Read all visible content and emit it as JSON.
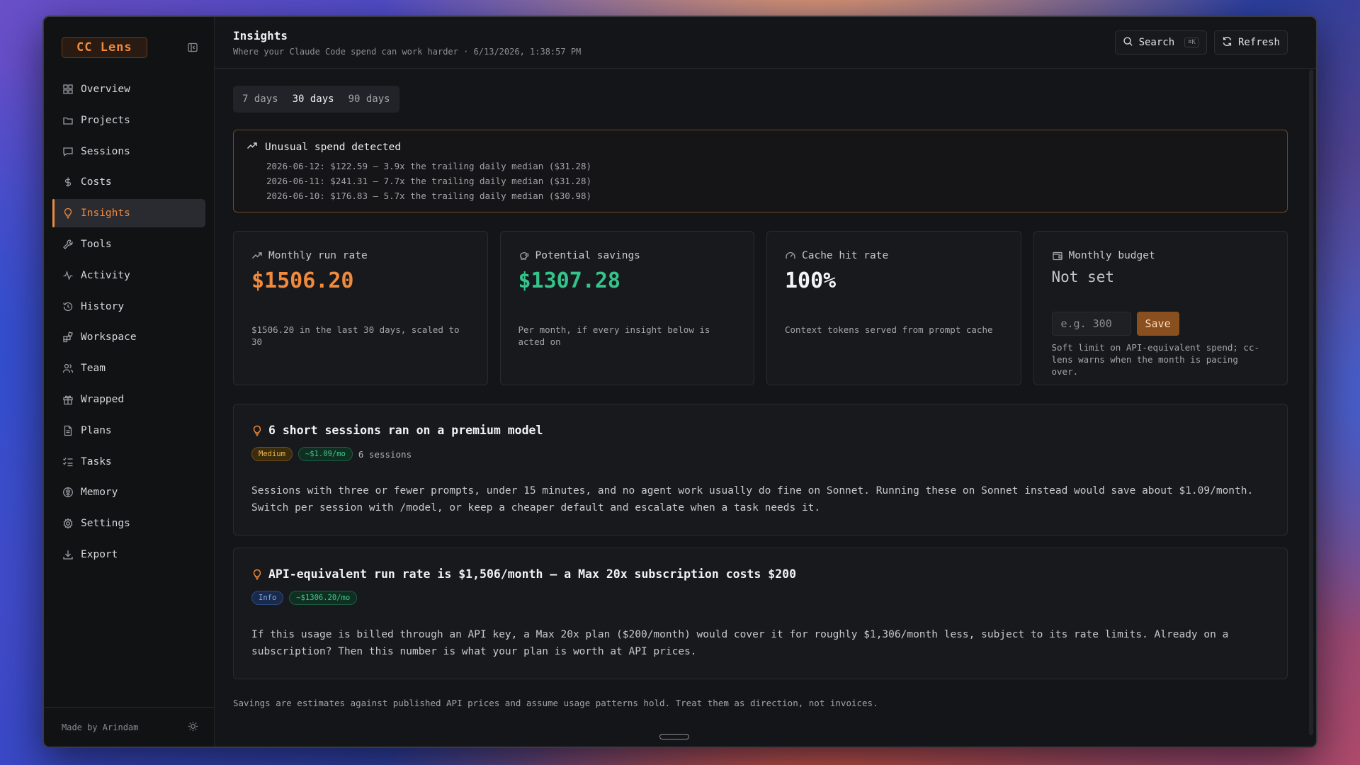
{
  "brand": {
    "name": "CC Lens"
  },
  "sidebar": {
    "items": [
      {
        "label": "Overview",
        "icon": "grid-icon"
      },
      {
        "label": "Projects",
        "icon": "folder-icon"
      },
      {
        "label": "Sessions",
        "icon": "chat-icon"
      },
      {
        "label": "Costs",
        "icon": "dollar-icon"
      },
      {
        "label": "Insights",
        "icon": "lightbulb-icon",
        "active": true
      },
      {
        "label": "Tools",
        "icon": "wrench-icon"
      },
      {
        "label": "Activity",
        "icon": "pulse-icon"
      },
      {
        "label": "History",
        "icon": "history-icon"
      },
      {
        "label": "Workspace",
        "icon": "blocks-icon"
      },
      {
        "label": "Team",
        "icon": "users-icon"
      },
      {
        "label": "Wrapped",
        "icon": "gift-icon"
      },
      {
        "label": "Plans",
        "icon": "document-icon"
      },
      {
        "label": "Tasks",
        "icon": "checklist-icon"
      },
      {
        "label": "Memory",
        "icon": "brain-icon"
      },
      {
        "label": "Settings",
        "icon": "gear-icon"
      },
      {
        "label": "Export",
        "icon": "download-icon"
      }
    ],
    "footer": "Made by Arindam"
  },
  "header": {
    "title": "Insights",
    "subtitle": "Where your Claude Code spend can work harder · 6/13/2026, 1:38:57 PM",
    "search_label": "Search",
    "search_shortcut": "⌘K",
    "refresh_label": "Refresh"
  },
  "range": {
    "options": [
      "7 days",
      "30 days",
      "90 days"
    ],
    "selected": "30 days"
  },
  "alert": {
    "title": "Unusual spend detected",
    "lines": [
      "2026-06-12: $122.59 — 3.9x the trailing daily median ($31.28)",
      "2026-06-11: $241.31 — 7.7x the trailing daily median ($31.28)",
      "2026-06-10: $176.83 — 5.7x the trailing daily median ($30.98)"
    ]
  },
  "stats": {
    "run_rate": {
      "label": "Monthly run rate",
      "value": "$1506.20",
      "desc": "$1506.20 in the last 30 days, scaled to 30"
    },
    "savings": {
      "label": "Potential savings",
      "value": "$1307.28",
      "desc": "Per month, if every insight below is acted on"
    },
    "cache": {
      "label": "Cache hit rate",
      "value": "100%",
      "desc": "Context tokens served from prompt cache"
    },
    "budget": {
      "label": "Monthly budget",
      "value": "Not set",
      "placeholder": "e.g. 300",
      "save_label": "Save",
      "desc": "Soft limit on API-equivalent spend; cc-lens warns when the month is pacing over."
    }
  },
  "insights": [
    {
      "title": "6 short sessions ran on a premium model",
      "severity": "Medium",
      "saving": "~$1.09/mo",
      "meta": "6 sessions",
      "body": "Sessions with three or fewer prompts, under 15 minutes, and no agent work usually do fine on Sonnet. Running these on Sonnet instead would save about $1.09/month. Switch per session with /model, or keep a cheaper default and escalate when a task needs it."
    },
    {
      "title": "API-equivalent run rate is $1,506/month — a Max 20x subscription costs $200",
      "severity": "Info",
      "saving": "~$1306.20/mo",
      "body": "If this usage is billed through an API key, a Max 20x plan ($200/month) would cover it for roughly $1,306/month less, subject to its rate limits. Already on a subscription? Then this number is what your plan is worth at API prices."
    }
  ],
  "footnote": "Savings are estimates against published API prices and assume usage patterns hold. Treat them as direction, not invoices.",
  "colors": {
    "accent": "#f08a3c",
    "success": "#34c48b",
    "bg": "#141518"
  }
}
